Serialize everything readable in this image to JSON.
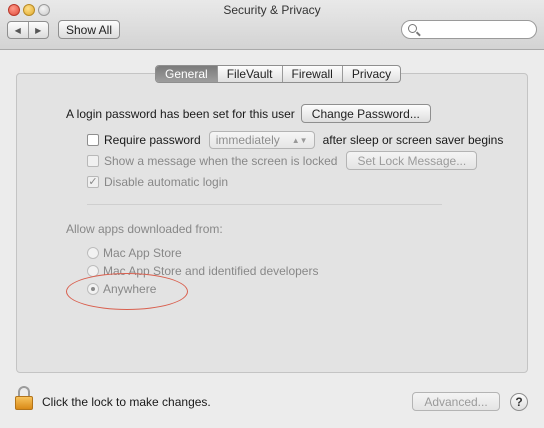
{
  "window": {
    "title": "Security & Privacy"
  },
  "toolbar": {
    "back_glyph": "◀",
    "forward_glyph": "▶",
    "show_all_label": "Show All",
    "search_placeholder": ""
  },
  "tabs": [
    {
      "label": "General",
      "active": true
    },
    {
      "label": "FileVault",
      "active": false
    },
    {
      "label": "Firewall",
      "active": false
    },
    {
      "label": "Privacy",
      "active": false
    }
  ],
  "general": {
    "login_password_text": "A login password has been set for this user",
    "change_password_label": "Change Password...",
    "require_password_label": "Require password",
    "require_password_delay": "immediately",
    "after_sleep_text": "after sleep or screen saver begins",
    "show_message_label": "Show a message when the screen is locked",
    "set_lock_message_label": "Set Lock Message...",
    "disable_auto_login_label": "Disable automatic login",
    "check_glyph": "✓"
  },
  "downloads": {
    "heading": "Allow apps downloaded from:",
    "options": [
      {
        "label": "Mac App Store",
        "selected": false
      },
      {
        "label": "Mac App Store and identified developers",
        "selected": false
      },
      {
        "label": "Anywhere",
        "selected": true
      }
    ]
  },
  "footer": {
    "lock_text": "Click the lock to make changes.",
    "advanced_label": "Advanced...",
    "help_glyph": "?"
  },
  "colors": {
    "annotation": "#d9604f",
    "lock_gold": "#e8a62c"
  },
  "icons": [
    "back-icon",
    "forward-icon",
    "search-icon",
    "lock-icon",
    "help-icon",
    "checkmark-icon"
  ]
}
